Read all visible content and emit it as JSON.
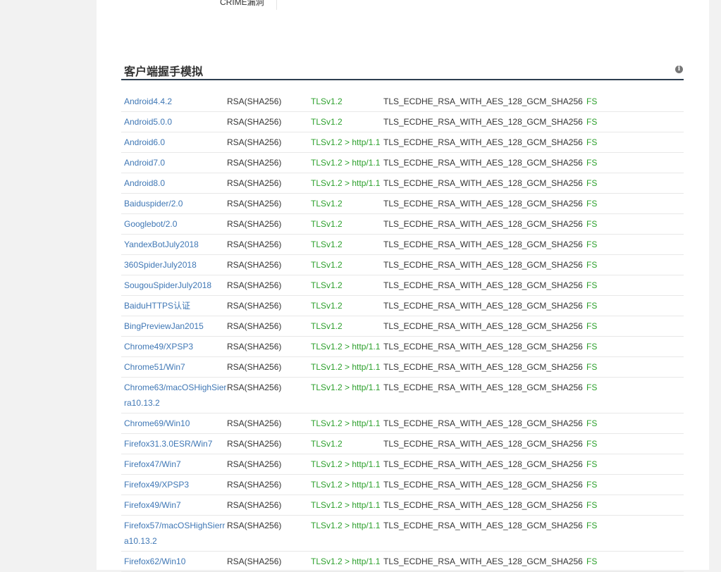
{
  "previous_section": {
    "row_label": "CRIME漏洞"
  },
  "section": {
    "title": "客户端握手模拟",
    "info_icon": "info-circle-icon"
  },
  "clients": [
    {
      "name": "Android4.4.2",
      "cert": "RSA(SHA256)",
      "protocol": "TLSv1.2",
      "cipher": "TLS_ECDHE_RSA_WITH_AES_128_GCM_SHA256",
      "fs": "FS"
    },
    {
      "name": "Android5.0.0",
      "cert": "RSA(SHA256)",
      "protocol": "TLSv1.2",
      "cipher": "TLS_ECDHE_RSA_WITH_AES_128_GCM_SHA256",
      "fs": "FS"
    },
    {
      "name": "Android6.0",
      "cert": "RSA(SHA256)",
      "protocol": "TLSv1.2 > http/1.1",
      "cipher": "TLS_ECDHE_RSA_WITH_AES_128_GCM_SHA256",
      "fs": "FS"
    },
    {
      "name": "Android7.0",
      "cert": "RSA(SHA256)",
      "protocol": "TLSv1.2 > http/1.1",
      "cipher": "TLS_ECDHE_RSA_WITH_AES_128_GCM_SHA256",
      "fs": "FS"
    },
    {
      "name": "Android8.0",
      "cert": "RSA(SHA256)",
      "protocol": "TLSv1.2 > http/1.1",
      "cipher": "TLS_ECDHE_RSA_WITH_AES_128_GCM_SHA256",
      "fs": "FS"
    },
    {
      "name": "Baiduspider/2.0",
      "cert": "RSA(SHA256)",
      "protocol": "TLSv1.2",
      "cipher": "TLS_ECDHE_RSA_WITH_AES_128_GCM_SHA256",
      "fs": "FS"
    },
    {
      "name": "Googlebot/2.0",
      "cert": "RSA(SHA256)",
      "protocol": "TLSv1.2",
      "cipher": "TLS_ECDHE_RSA_WITH_AES_128_GCM_SHA256",
      "fs": "FS"
    },
    {
      "name": "YandexBotJuly2018",
      "cert": "RSA(SHA256)",
      "protocol": "TLSv1.2",
      "cipher": "TLS_ECDHE_RSA_WITH_AES_128_GCM_SHA256",
      "fs": "FS"
    },
    {
      "name": "360SpiderJuly2018",
      "cert": "RSA(SHA256)",
      "protocol": "TLSv1.2",
      "cipher": "TLS_ECDHE_RSA_WITH_AES_128_GCM_SHA256",
      "fs": "FS"
    },
    {
      "name": "SougouSpiderJuly2018",
      "cert": "RSA(SHA256)",
      "protocol": "TLSv1.2",
      "cipher": "TLS_ECDHE_RSA_WITH_AES_128_GCM_SHA256",
      "fs": "FS"
    },
    {
      "name": "BaiduHTTPS认证",
      "cert": "RSA(SHA256)",
      "protocol": "TLSv1.2",
      "cipher": "TLS_ECDHE_RSA_WITH_AES_128_GCM_SHA256",
      "fs": "FS"
    },
    {
      "name": "BingPreviewJan2015",
      "cert": "RSA(SHA256)",
      "protocol": "TLSv1.2",
      "cipher": "TLS_ECDHE_RSA_WITH_AES_128_GCM_SHA256",
      "fs": "FS"
    },
    {
      "name": "Chrome49/XPSP3",
      "cert": "RSA(SHA256)",
      "protocol": "TLSv1.2 > http/1.1",
      "cipher": "TLS_ECDHE_RSA_WITH_AES_128_GCM_SHA256",
      "fs": "FS"
    },
    {
      "name": "Chrome51/Win7",
      "cert": "RSA(SHA256)",
      "protocol": "TLSv1.2 > http/1.1",
      "cipher": "TLS_ECDHE_RSA_WITH_AES_128_GCM_SHA256",
      "fs": "FS"
    },
    {
      "name": "Chrome63/macOSHighSierra10.13.2",
      "cert": "RSA(SHA256)",
      "protocol": "TLSv1.2 > http/1.1",
      "cipher": "TLS_ECDHE_RSA_WITH_AES_128_GCM_SHA256",
      "fs": "FS",
      "wrap": true
    },
    {
      "name": "Chrome69/Win10",
      "cert": "RSA(SHA256)",
      "protocol": "TLSv1.2 > http/1.1",
      "cipher": "TLS_ECDHE_RSA_WITH_AES_128_GCM_SHA256",
      "fs": "FS"
    },
    {
      "name": "Firefox31.3.0ESR/Win7",
      "cert": "RSA(SHA256)",
      "protocol": "TLSv1.2",
      "cipher": "TLS_ECDHE_RSA_WITH_AES_128_GCM_SHA256",
      "fs": "FS"
    },
    {
      "name": "Firefox47/Win7",
      "cert": "RSA(SHA256)",
      "protocol": "TLSv1.2 > http/1.1",
      "cipher": "TLS_ECDHE_RSA_WITH_AES_128_GCM_SHA256",
      "fs": "FS"
    },
    {
      "name": "Firefox49/XPSP3",
      "cert": "RSA(SHA256)",
      "protocol": "TLSv1.2 > http/1.1",
      "cipher": "TLS_ECDHE_RSA_WITH_AES_128_GCM_SHA256",
      "fs": "FS"
    },
    {
      "name": "Firefox49/Win7",
      "cert": "RSA(SHA256)",
      "protocol": "TLSv1.2 > http/1.1",
      "cipher": "TLS_ECDHE_RSA_WITH_AES_128_GCM_SHA256",
      "fs": "FS"
    },
    {
      "name": "Firefox57/macOSHighSierra10.13.2",
      "cert": "RSA(SHA256)",
      "protocol": "TLSv1.2 > http/1.1",
      "cipher": "TLS_ECDHE_RSA_WITH_AES_128_GCM_SHA256",
      "fs": "FS",
      "wrap": true
    },
    {
      "name": "Firefox62/Win10",
      "cert": "RSA(SHA256)",
      "protocol": "TLSv1.2 > http/1.1",
      "cipher": "TLS_ECDHE_RSA_WITH_AES_128_GCM_SHA256",
      "fs": "FS"
    }
  ]
}
